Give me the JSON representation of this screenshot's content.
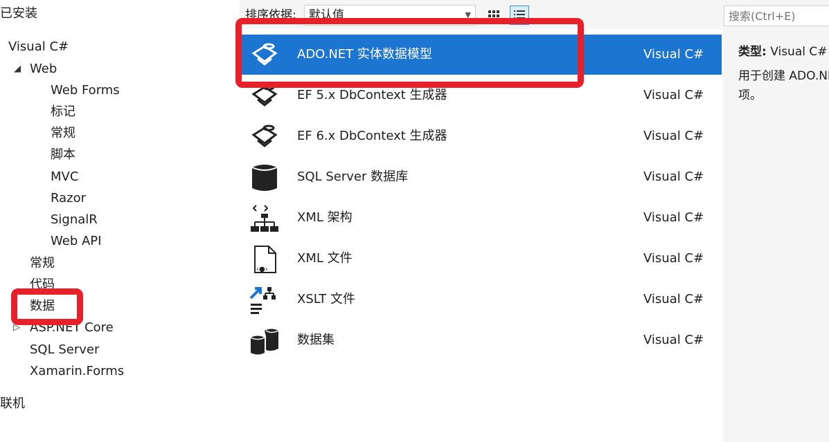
{
  "tree": {
    "installed": "已安装",
    "visual_csharp": "Visual C#",
    "web": "Web",
    "web_children": [
      "Web Forms",
      "标记",
      "常规",
      "脚本",
      "MVC",
      "Razor",
      "SignalR",
      "Web API"
    ],
    "general": "常规",
    "code": "代码",
    "data": "数据",
    "aspnet_core": "ASP.NET Core",
    "sql_server": "SQL Server",
    "xamarin_forms": "Xamarin.Forms",
    "online": "联机"
  },
  "sortbar": {
    "label": "排序依据:",
    "value": "默认值"
  },
  "items": [
    {
      "name": "ADO.NET 实体数据模型",
      "lang": "Visual C#",
      "icon": "ado-entity-icon",
      "selected": true
    },
    {
      "name": "EF 5.x DbContext 生成器",
      "lang": "Visual C#",
      "icon": "ef-generator-icon"
    },
    {
      "name": "EF 6.x DbContext 生成器",
      "lang": "Visual C#",
      "icon": "ef-generator-icon"
    },
    {
      "name": "SQL Server 数据库",
      "lang": "Visual C#",
      "icon": "database-icon"
    },
    {
      "name": "XML 架构",
      "lang": "Visual C#",
      "icon": "xml-schema-icon"
    },
    {
      "name": "XML 文件",
      "lang": "Visual C#",
      "icon": "xml-file-icon"
    },
    {
      "name": "XSLT 文件",
      "lang": "Visual C#",
      "icon": "xslt-file-icon"
    },
    {
      "name": "数据集",
      "lang": "Visual C#",
      "icon": "dataset-icon"
    }
  ],
  "detail": {
    "search_placeholder": "搜索(Ctrl+E)",
    "type_label": "类型:",
    "type_value": "Visual C#",
    "desc_line1": "用于创建 ADO.NET",
    "desc_line2": "项。"
  },
  "colors": {
    "selection": "#1c75d1",
    "highlight": "#e8202a"
  }
}
